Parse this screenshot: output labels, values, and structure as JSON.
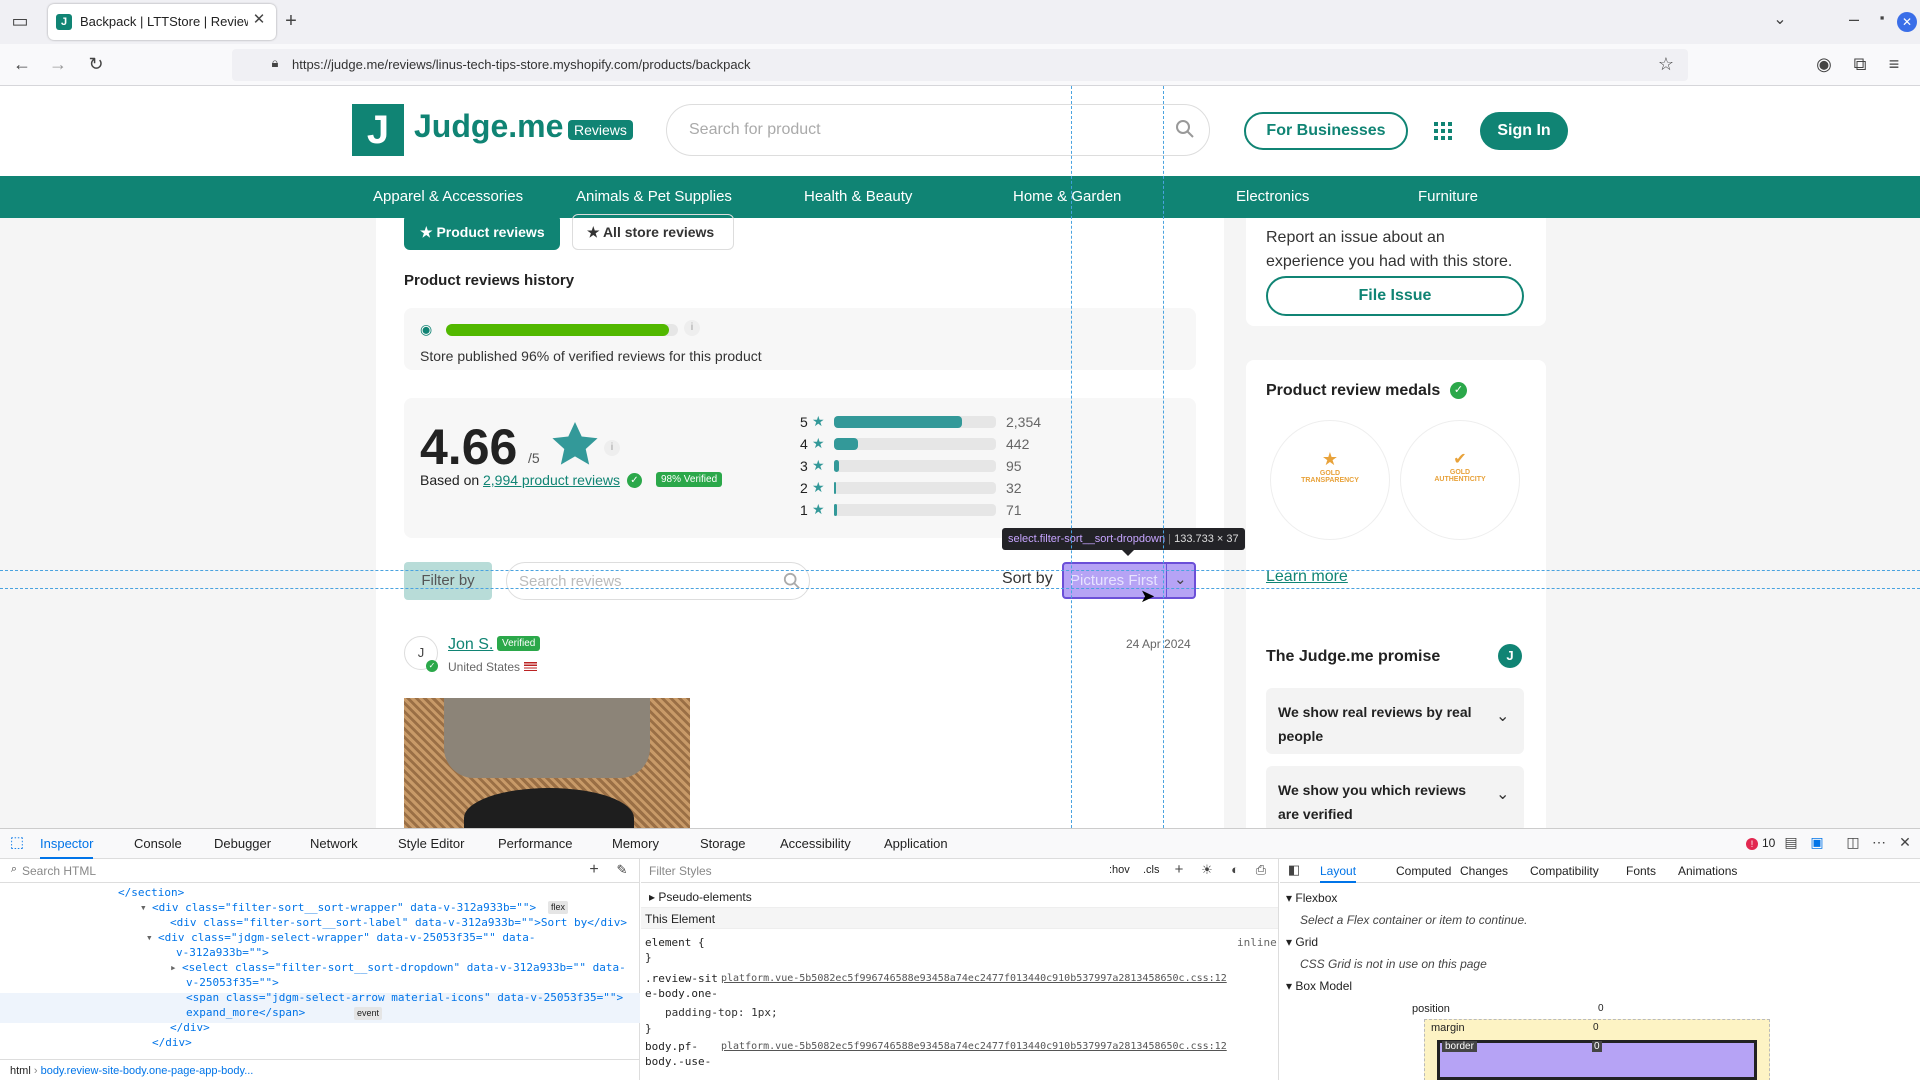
{
  "browser": {
    "tab_title": "Backpack | LTTStore | Review",
    "url": "https://judge.me/reviews/linus-tech-tips-store.myshopify.com/products/backpack"
  },
  "header": {
    "logo_letter": "J",
    "logo_text": "Judge.me",
    "logo_badge": "Reviews",
    "search_placeholder": "Search for product",
    "for_businesses": "For Businesses",
    "sign_in": "Sign In"
  },
  "categories": [
    "Apparel & Accessories",
    "Animals & Pet Supplies",
    "Health & Beauty",
    "Home & Garden",
    "Electronics",
    "Furniture"
  ],
  "tabs": {
    "product_reviews": "Product reviews",
    "all_store_reviews": "All store reviews"
  },
  "history": {
    "title": "Product reviews history",
    "published_text": "Store published 96% of verified reviews for this product",
    "published_fraction": 0.96
  },
  "rating": {
    "score": "4.66",
    "out_of": "/5",
    "based_on": "Based on",
    "reviews_link": "2,994 product reviews",
    "verified_badge": "98% Verified",
    "breakdown": [
      {
        "stars": "5",
        "count": "2,354",
        "fraction": 0.79
      },
      {
        "stars": "4",
        "count": "442",
        "fraction": 0.15
      },
      {
        "stars": "3",
        "count": "95",
        "fraction": 0.03
      },
      {
        "stars": "2",
        "count": "32",
        "fraction": 0.01
      },
      {
        "stars": "1",
        "count": "71",
        "fraction": 0.02
      }
    ]
  },
  "filter": {
    "filter_label": "Filter by",
    "search_placeholder": "Search reviews",
    "sort_label": "Sort by",
    "sort_value": "Pictures First",
    "tooltip_selector": "select.filter-sort__sort-dropdown",
    "tooltip_size": "133.733 × 37"
  },
  "review": {
    "avatar_initial": "J",
    "author": "Jon S.",
    "verified": "Verified",
    "location": "United States",
    "date": "24 Apr 2024"
  },
  "sidebar": {
    "report_text": "Report an issue about an experience you had with this store.",
    "file_issue": "File Issue",
    "medals_title": "Product review medals",
    "medal1_line1": "GOLD",
    "medal1_line2": "TRANSPARENCY",
    "medal2_line1": "GOLD",
    "medal2_line2": "AUTHENTICITY",
    "learn_more": "Learn more",
    "promise_title": "The Judge.me promise",
    "promise_items": [
      "We show real reviews by real people",
      "We show you which reviews are verified"
    ]
  },
  "devtools": {
    "tabs": [
      "Inspector",
      "Console",
      "Debugger",
      "Network",
      "Style Editor",
      "Performance",
      "Memory",
      "Storage",
      "Accessibility",
      "Application"
    ],
    "error_count": "10",
    "search_html_placeholder": "Search HTML",
    "filter_styles_placeholder": "Filter Styles",
    "hov": ":hov",
    "cls": ".cls",
    "html_lines": [
      "</section>",
      "<div class=\"filter-sort__sort-wrapper\" data-v-312a933b=\"\">",
      "<div class=\"filter-sort__sort-label\" data-v-312a933b=\"\">Sort by</div>",
      "<div class=\"jdgm-select-wrapper\" data-v-25053f35=\"\" data-",
      "v-312a933b=\"\">",
      "<select class=\"filter-sort__sort-dropdown\" data-v-312a933b=\"\" data-",
      "v-25053f35=\"\">",
      "<span class=\"jdgm-select-arrow material-icons\" data-v-25053f35=\"\">",
      "expand_more</span>",
      "</div>",
      "</div>",
      "</div>"
    ],
    "flex_badge": "flex",
    "event_badge": "event",
    "breadcrumb_html": "html",
    "breadcrumb_body": "body.review-site-body.one-page-app-body...",
    "pseudo_elements": "Pseudo-elements",
    "this_element": "This Element",
    "element_rule": "element",
    "inline": "inline",
    "rule1_selector": ".review-site-body.one-page-app-body:not(.force-hide-header-search)",
    "rule1_source": "platform.vue-5b5082ec5f996746588e93458a74ec2477f013440c910b537997a2813458650c.css:12",
    "rule1_prop": "padding-top: 1px;",
    "rule2_selector": "body.pf-body.-use-",
    "rule2_source": "platform.vue-5b5082ec5f996746588e93458a74ec2477f013440c910b537997a2813458650c.css:12",
    "layout_tabs": [
      "Layout",
      "Computed",
      "Changes",
      "Compatibility",
      "Fonts",
      "Animations"
    ],
    "flexbox": "Flexbox",
    "flexbox_msg": "Select a Flex container or item to continue.",
    "grid": "Grid",
    "grid_msg": "CSS Grid is not in use on this page",
    "box_model": "Box Model",
    "bm_position": "position",
    "bm_margin": "margin",
    "bm_border": "border",
    "bm_zero": "0"
  },
  "colors": {
    "brand": "#108474",
    "bar": "#339999",
    "green_bar": "#52b800",
    "highlight": "#b6a3f5"
  }
}
